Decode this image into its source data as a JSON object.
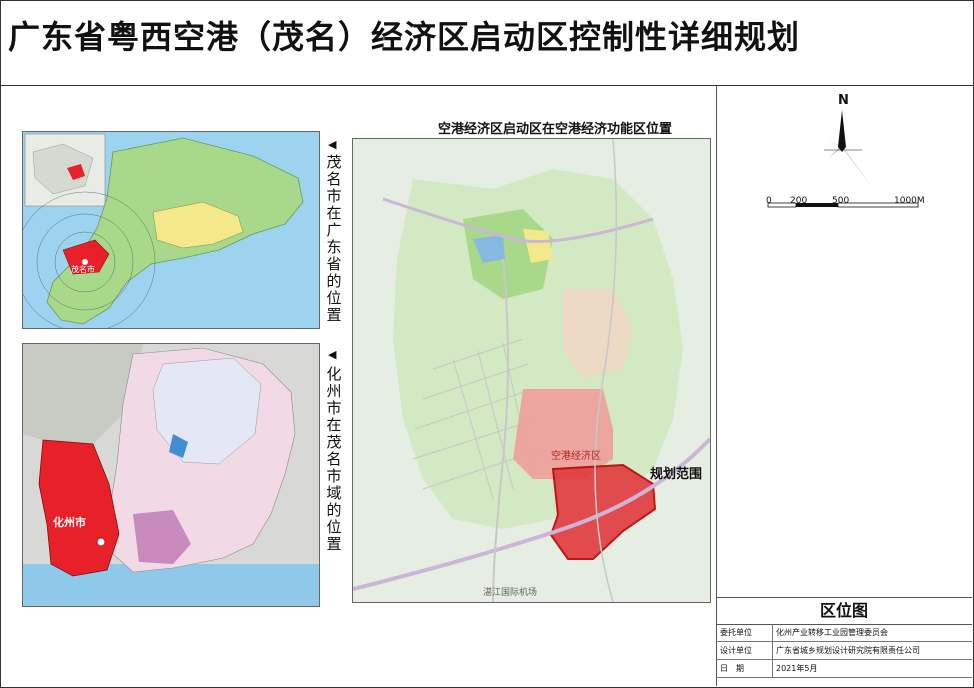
{
  "title": "广东省粤西空港（茂名）经济区启动区控制性详细规划",
  "map_caption": "空港经济区启动区在空港经济功能区位置",
  "inset1": {
    "label": "茂名市在广东省的位置",
    "city_label": "茂名市"
  },
  "inset2": {
    "label": "化州市在茂名市域的位置",
    "city_label": "化州市"
  },
  "main_map": {
    "zone_label": "空港经济区",
    "plan_label": "规划范围",
    "airport_label": "湛江国际机场"
  },
  "compass": {
    "north": "N"
  },
  "scale": {
    "ticks": [
      "0",
      "200",
      "500",
      "1000M"
    ]
  },
  "legend": {
    "title": "区位图",
    "rows": [
      {
        "key": "委托单位",
        "value": "化州产业转移工业园管理委员会"
      },
      {
        "key": "设计单位",
        "value": "广东省城乡规划设计研究院有限责任公司"
      },
      {
        "key": "日　期",
        "value": "2021年5月"
      }
    ]
  },
  "colors": {
    "red_zone": "#e8202a",
    "plan_area": "#e23a3f",
    "yellow_zone": "#f3e98a",
    "green_zone": "#a8d88a",
    "water": "#9cd3ee"
  }
}
